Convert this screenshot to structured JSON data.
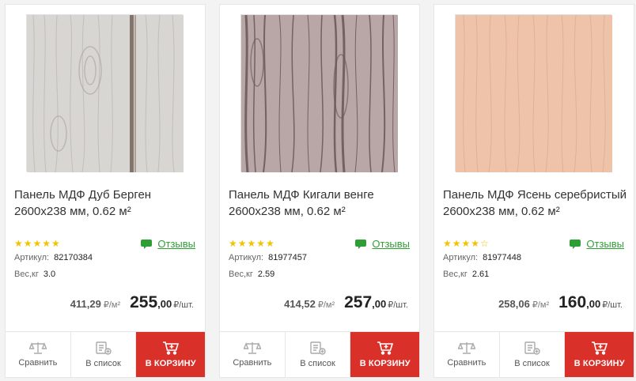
{
  "products": [
    {
      "title": "Панель МДФ Дуб Берген 2600x238 мм, 0.62 м²",
      "stars": "★★★★★",
      "reviews_label": "Отзывы",
      "article_label": "Артикул:",
      "article": "82170384",
      "weight_label": "Вес,кг",
      "weight": "3.0",
      "old_price": "411,29",
      "old_unit": "₽/м²",
      "price_int": "255",
      "price_frac": ",00",
      "price_unit": "₽/шт.",
      "compare_label": "Сравнить",
      "list_label": "В список",
      "cart_label": "В КОРЗИНУ",
      "texture": "oak-bergen"
    },
    {
      "title": "Панель МДФ Кигали венге 2600x238 мм, 0.62 м²",
      "stars": "★★★★★",
      "reviews_label": "Отзывы",
      "article_label": "Артикул:",
      "article": "81977457",
      "weight_label": "Вес,кг",
      "weight": "2.59",
      "old_price": "414,52",
      "old_unit": "₽/м²",
      "price_int": "257",
      "price_frac": ",00",
      "price_unit": "₽/шт.",
      "compare_label": "Сравнить",
      "list_label": "В список",
      "cart_label": "В КОРЗИНУ",
      "texture": "kigali-wenge"
    },
    {
      "title": "Панель МДФ Ясень серебристый 2600x238 мм, 0.62 м²",
      "stars": "★★★★☆",
      "reviews_label": "Отзывы",
      "article_label": "Артикул:",
      "article": "81977448",
      "weight_label": "Вес,кг",
      "weight": "2.61",
      "old_price": "258,06",
      "old_unit": "₽/м²",
      "price_int": "160",
      "price_frac": ",00",
      "price_unit": "₽/шт.",
      "compare_label": "Сравнить",
      "list_label": "В список",
      "cart_label": "В КОРЗИНУ",
      "texture": "silver-ash"
    }
  ],
  "colors": {
    "accent_red": "#d9302a",
    "link_green": "#2e9e35",
    "star_yellow": "#f3c200"
  },
  "icons": {
    "reviews": "chat-bubble-icon",
    "compare": "scales-icon",
    "list": "list-add-icon",
    "cart": "cart-plus-icon"
  }
}
